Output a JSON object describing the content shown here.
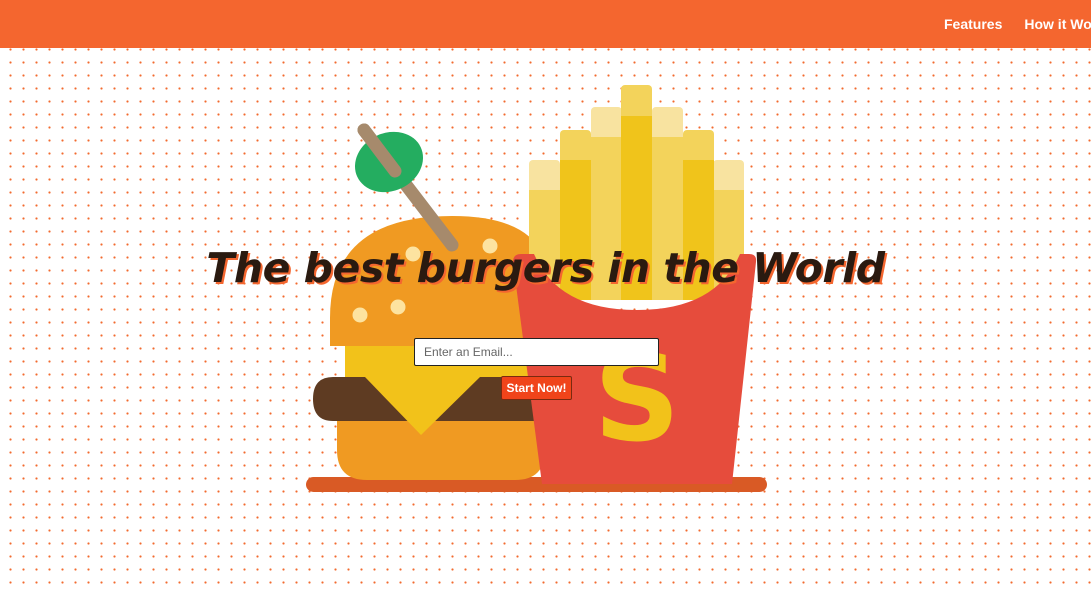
{
  "nav": {
    "links": [
      "Features",
      "How it Works"
    ]
  },
  "hero": {
    "headline": "The best burgers in the World",
    "email_placeholder": "Enter an Email...",
    "cta_label": "Start Now!"
  },
  "colors": {
    "brand_orange": "#f4662f",
    "button_red": "#f0441a",
    "bun": "#f09a22",
    "cheese": "#f2c21a",
    "patty": "#5e3b22",
    "fries_box": "#e64c3c",
    "olive": "#24ad60"
  },
  "icons": [
    "burger-illustration",
    "fries-illustration",
    "olive-toothpick-icon",
    "dollar-sign-icon"
  ]
}
